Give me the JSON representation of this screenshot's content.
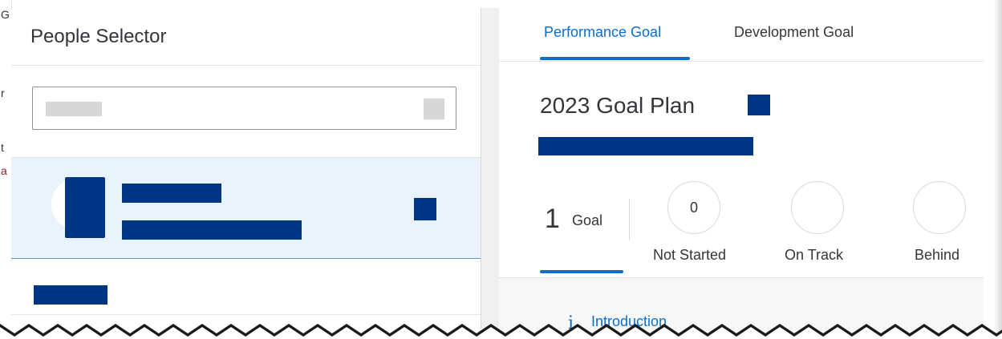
{
  "background": {
    "left_strip_chars": [
      "G",
      "r",
      "t",
      "a"
    ]
  },
  "people_selector": {
    "title": "People Selector",
    "search": {
      "value": "",
      "placeholder": ""
    },
    "selected_person": {
      "redacted": true
    }
  },
  "goal_panel": {
    "tabs": [
      {
        "label": "Performance Goal",
        "active": true
      },
      {
        "label": "Development Goal",
        "active": false
      }
    ],
    "plan_title": "2023 Goal Plan",
    "stats": {
      "goal_count": "1",
      "goal_label": "Goal",
      "items": [
        {
          "count": "0",
          "label": "Not Started"
        },
        {
          "count": "",
          "label": "On Track"
        },
        {
          "count": "",
          "label": "Behind"
        }
      ]
    },
    "introduction": {
      "icon": "info-icon",
      "icon_glyph": "i",
      "label": "Introduction"
    }
  },
  "colors": {
    "accent": "#0a6ed1",
    "redaction": "#003584",
    "selected_row_bg": "#e8f3fd"
  }
}
